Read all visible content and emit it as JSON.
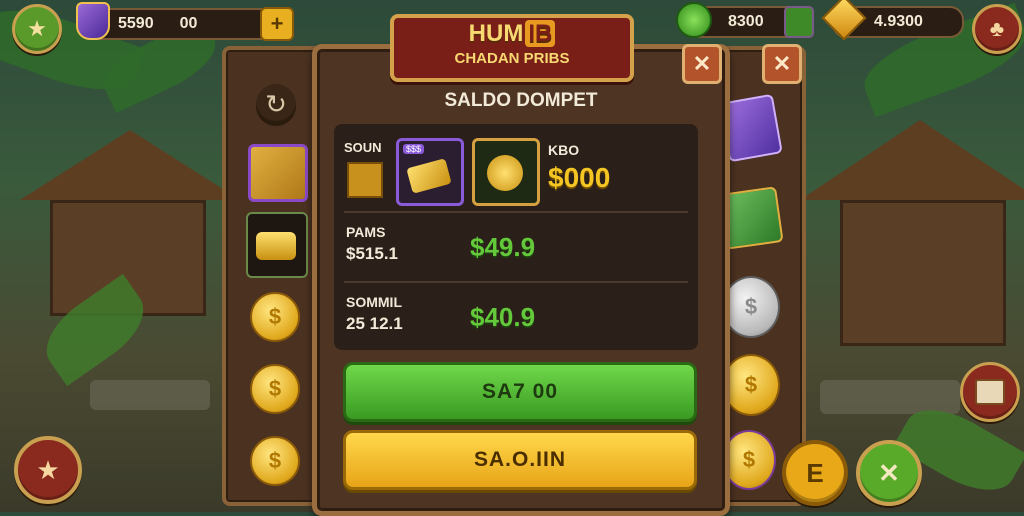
{
  "hud": {
    "gold_amount": "5590",
    "gold_extra": "00",
    "add_label": "+",
    "gem_amount": "8300",
    "energy_amount": "4.9300"
  },
  "title": {
    "line1a": "HUM",
    "line1b": "IB",
    "line2": "CHADAN PRIBS"
  },
  "wallet": {
    "heading": "SALDO DOMPET",
    "slot_label": "SOUN",
    "card_tag": "$$$",
    "balance_label": "KBO",
    "balance_value": "$000",
    "rows": [
      {
        "label": "PAMS",
        "sub": "$515.1",
        "value": "$49.9"
      },
      {
        "label": "SOMMIL",
        "sub": "25 12.1",
        "value": "$40.9"
      }
    ],
    "primary_button": "SA7 00",
    "secondary_button": "SA.O.IIN"
  },
  "colors": {
    "accent_green": "#63c93a",
    "accent_gold": "#f5c623",
    "panel_brown": "#4e3422",
    "banner_red": "#7a1f18"
  },
  "icons": {
    "close": "close-icon",
    "star": "star-icon",
    "refresh": "refresh-icon",
    "dollar": "dollar-icon",
    "chest": "chest-icon"
  }
}
